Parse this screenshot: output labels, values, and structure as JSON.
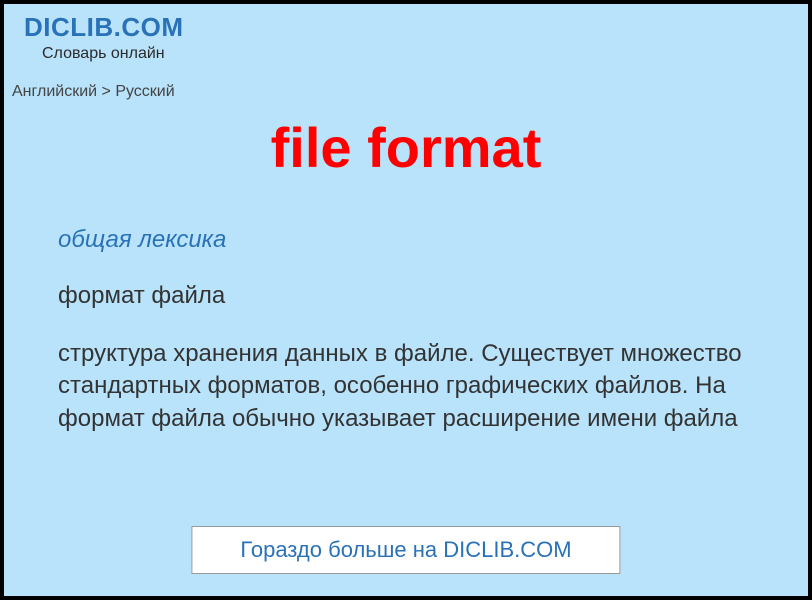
{
  "header": {
    "site_title": "DICLIB.COM",
    "site_subtitle": "Словарь онлайн"
  },
  "breadcrumb": {
    "text": "Английский > Русский"
  },
  "entry": {
    "headword": "file format",
    "category": "общая лексика",
    "definition_short": "формат файла",
    "definition_long": "структура хранения данных в файле. Существует множество стандартных форматов, особенно графических файлов. На формат файла обычно указывает расширение имени файла"
  },
  "cta": {
    "label": "Гораздо больше на DICLIB.COM"
  }
}
